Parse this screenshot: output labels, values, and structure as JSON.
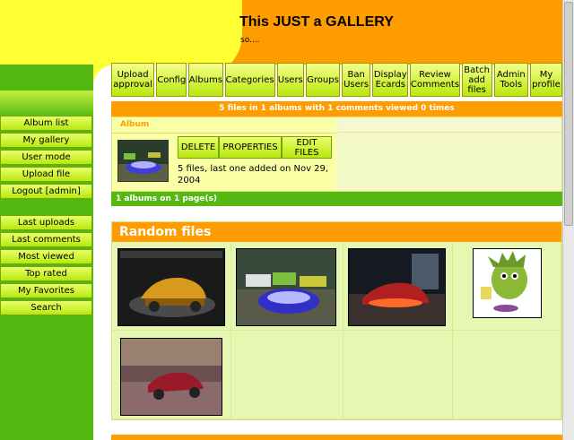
{
  "header": {
    "title": "This JUST a GALLERY",
    "subtitle": "so...."
  },
  "top_nav": [
    "Upload\napproval",
    "Config",
    "Albums",
    "Categories",
    "Users",
    "Groups",
    "Ban\nUsers",
    "Display\nEcards",
    "Review\nComments",
    "Batch\nadd\nfiles",
    "Admin\nTools",
    "My\nprofile"
  ],
  "side_nav": {
    "group1": [
      "Album list",
      "My gallery",
      "User mode",
      "Upload file",
      "Logout [admin]"
    ],
    "group2": [
      "Last uploads",
      "Last comments",
      "Most viewed",
      "Top rated",
      "My Favorites",
      "Search"
    ]
  },
  "stats": "5 files in 1 albums with 1 comments viewed 0 times",
  "album": {
    "label": "Album",
    "buttons": [
      "DELETE",
      "PROPERTIES",
      "EDIT\nFILES"
    ],
    "info": "5 files, last one added on Nov 29, 2004"
  },
  "pages": "1 albums on 1 page(s)",
  "random": {
    "title": "Random files"
  },
  "colors": {
    "orange": "#ff9c00",
    "yellow": "#ffff33",
    "green": "#55b812",
    "lime": "#b8e80e"
  }
}
